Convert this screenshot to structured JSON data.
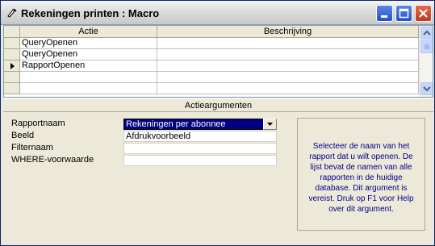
{
  "window": {
    "title": "Rekeningen printen : Macro"
  },
  "grid": {
    "columns": [
      "Actie",
      "Beschrijving"
    ],
    "rows": [
      {
        "actie": "QueryOpenen",
        "beschrijving": ""
      },
      {
        "actie": "QueryOpenen",
        "beschrijving": ""
      },
      {
        "actie": "RapportOpenen",
        "beschrijving": ""
      },
      {
        "actie": "",
        "beschrijving": ""
      },
      {
        "actie": "",
        "beschrijving": ""
      }
    ],
    "current_row_index": 2
  },
  "arguments": {
    "header": "Actieargumenten",
    "fields": [
      {
        "label": "Rapportnaam",
        "value": "Rekeningen per abonnee",
        "selected": true,
        "dropdown": true
      },
      {
        "label": "Beeld",
        "value": "Afdrukvoorbeeld"
      },
      {
        "label": "Filternaam",
        "value": ""
      },
      {
        "label": "WHERE-voorwaarde",
        "value": ""
      }
    ],
    "help_text": "Selecteer de naam van het rapport dat u wilt openen. De lijst bevat de namen van alle rapporten in de huidige database. Dit argument is vereist. Druk op F1 voor Help over dit argument."
  },
  "icons": {
    "title": "macro-icon",
    "minimize": "minimize-icon",
    "maximize": "maximize-icon",
    "close": "close-icon",
    "row_pointer": "row-pointer-icon",
    "dropdown": "chevron-down-icon",
    "scroll_up": "scroll-up-icon",
    "scroll_down": "scroll-down-icon"
  },
  "colors": {
    "selection": "#000080",
    "help_text": "#00008b",
    "close_button": "#c2381c"
  }
}
